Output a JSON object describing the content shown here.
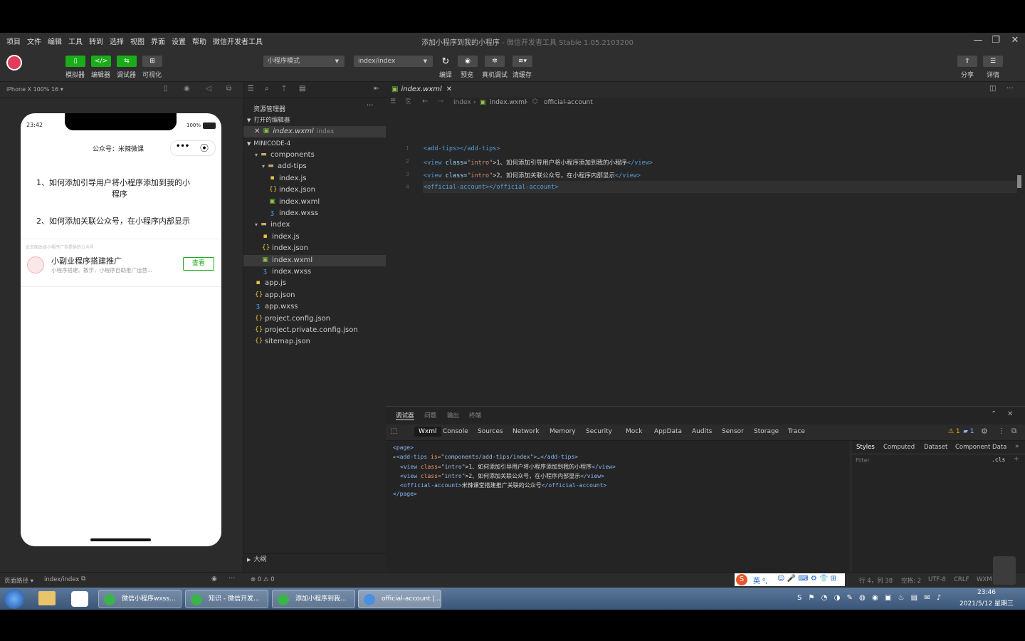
{
  "menu": {
    "items": [
      "项目",
      "文件",
      "编辑",
      "工具",
      "转到",
      "选择",
      "视图",
      "界面",
      "设置",
      "帮助",
      "微信开发者工具"
    ],
    "title": "添加小程序到我的小程序",
    "title_sub": " - 微信开发者工具 Stable 1.05.2103200"
  },
  "toolbar": {
    "simulator": "模拟器",
    "editor": "编辑器",
    "debugger": "调试器",
    "visual": "可视化",
    "mode": "小程序模式",
    "page": "index/index",
    "compile": "编译",
    "preview": "预览",
    "real_debug": "真机调试",
    "clear_cache": "清缓存",
    "share": "分享",
    "detail": "详情"
  },
  "sim": {
    "device": "iPhone X 100% 16 ▾",
    "time": "23:42",
    "battery": "100%",
    "nav_title": "公众号：米辣微课",
    "item1": "1、如何添加引导用户将小程序添加到我的小",
    "item1b": "程序",
    "item2": "2、如何添加关联公众号，在小程序内部显示",
    "oa_hint": "此页面由该小程序广告提供的公众号",
    "oa_name": "小副业程序搭建推广",
    "oa_desc": "小程序搭建、教学，小程序自助推广运营...",
    "oa_btn": "查看"
  },
  "explorer": {
    "title": "资源管理器",
    "open_editors": "打开的编辑器",
    "open_file": "index.wxml",
    "open_file_dir": "index",
    "project": "MINICODE-4",
    "tree": [
      {
        "name": "components",
        "type": "folder",
        "indent": 1
      },
      {
        "name": "add-tips",
        "type": "folder",
        "indent": 2
      },
      {
        "name": "index.js",
        "type": "js",
        "indent": 3
      },
      {
        "name": "index.json",
        "type": "json",
        "indent": 3
      },
      {
        "name": "index.wxml",
        "type": "wxml",
        "indent": 3
      },
      {
        "name": "index.wxss",
        "type": "wxss",
        "indent": 3
      },
      {
        "name": "index",
        "type": "folder",
        "indent": 1
      },
      {
        "name": "index.js",
        "type": "js",
        "indent": 2
      },
      {
        "name": "index.json",
        "type": "json",
        "indent": 2
      },
      {
        "name": "index.wxml",
        "type": "wxml",
        "indent": 2,
        "selected": true
      },
      {
        "name": "index.wxss",
        "type": "wxss",
        "indent": 2
      },
      {
        "name": "app.js",
        "type": "js",
        "indent": 1
      },
      {
        "name": "app.json",
        "type": "json",
        "indent": 1
      },
      {
        "name": "app.wxss",
        "type": "wxss",
        "indent": 1
      },
      {
        "name": "project.config.json",
        "type": "json",
        "indent": 1
      },
      {
        "name": "project.private.config.json",
        "type": "json",
        "indent": 1
      },
      {
        "name": "sitemap.json",
        "type": "json",
        "indent": 1
      }
    ],
    "outline": "大纲"
  },
  "editor": {
    "tab": "index.wxml",
    "crumb1": "index",
    "crumb2": "index.wxml",
    "crumb3": "official-account",
    "lines": [
      {
        "n": "1",
        "open": "<add-tips>",
        "attr": "",
        "val": "",
        "text": "",
        "close": "</add-tips>"
      },
      {
        "n": "2",
        "open": "<view ",
        "attr": "class=",
        "val": "\"intro\"",
        "text": ">1、如何添加引导用户将小程序添加到我的小程序",
        "close": "</view>"
      },
      {
        "n": "3",
        "open": "<view ",
        "attr": "class=",
        "val": "\"intro\"",
        "text": ">2、如何添加关联公众号，在小程序内部显示",
        "close": "</view>"
      },
      {
        "n": "4",
        "open": "<official-account>",
        "attr": "",
        "val": "",
        "text": "",
        "close": "</official-account>"
      }
    ]
  },
  "devtools": {
    "panel_tabs": [
      "调试器",
      "问题",
      "输出",
      "终端"
    ],
    "tabs": [
      "Wxml",
      "Console",
      "Sources",
      "Network",
      "Memory",
      "Security",
      "Mock",
      "AppData",
      "Audits",
      "Sensor",
      "Storage",
      "Trace"
    ],
    "warn": "⚠ 1",
    "info": "1",
    "style_tabs": [
      "Styles",
      "Computed",
      "Dataset",
      "Component Data"
    ],
    "filter": "Filter",
    "cls": ".cls",
    "dom": {
      "page_open": "<page>",
      "l1_tag": "<add-tips ",
      "l1_att": "is=",
      "l1_val": "\"components/add-tips/index\"",
      "l1_rest": ">…</add-tips>",
      "l2_tag": "<view ",
      "l2_att": "class=",
      "l2_val": "\"intro\"",
      "l2_txt": ">1、如何添加引导用户将小程序添加到我的小程序",
      "l2_close": "</view>",
      "l3_txt": ">2、如何添加关联公众号，在小程序内部显示",
      "l4_tag": "<official-account>",
      "l4_txt": "米辣课堂搭建推广关联的公众号",
      "l4_close": "</official-account>",
      "page_close": "</page>"
    }
  },
  "status": {
    "path_label": "页面路径",
    "path": "index/index",
    "errors": "⊗ 0 ⚠ 0",
    "pos": "行 4，列 38",
    "spaces": "空格: 2",
    "enc": "UTF-8",
    "eol": "CRLF",
    "lang": "WXM"
  },
  "taskbar": {
    "tasks": [
      "微信小程序wxss...",
      "知识 - 微信开发...",
      "添加小程序到我...",
      "official-account |..."
    ],
    "time": "23:46",
    "date": "2021/5/12 星期三"
  },
  "colors": {
    "accent": "#1aad19",
    "bg": "#262626"
  }
}
